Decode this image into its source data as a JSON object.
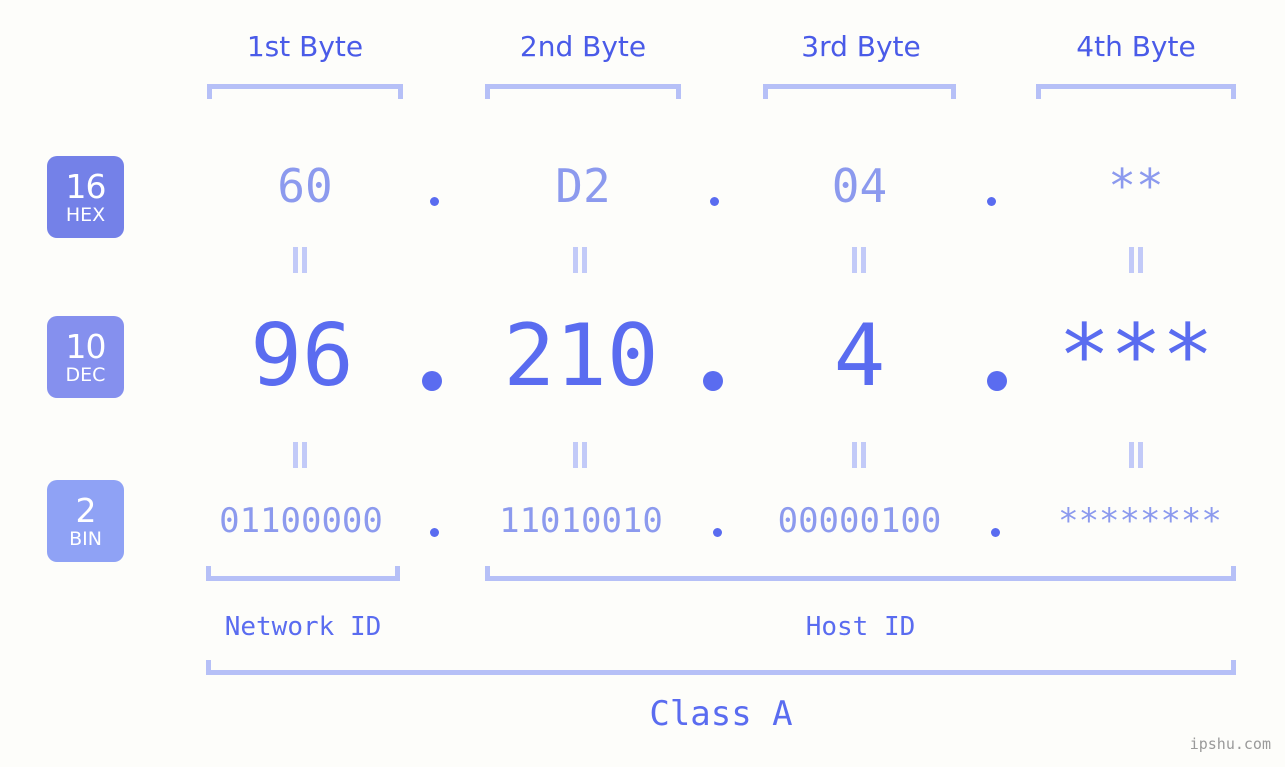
{
  "meta": {
    "watermark": "ipshu.com",
    "background_color": "#fdfdfa",
    "accent_color": "#5a6cf0",
    "accent_light_color": "#8c9aee",
    "bracket_color": "#b6c0f7"
  },
  "byte_headers": [
    {
      "label": "1st Byte"
    },
    {
      "label": "2nd Byte"
    },
    {
      "label": "3rd Byte"
    },
    {
      "label": "4th Byte"
    }
  ],
  "bases": [
    {
      "number": "16",
      "name": "HEX",
      "color": "#7481e8"
    },
    {
      "number": "10",
      "name": "DEC",
      "color": "#8590ee"
    },
    {
      "number": "2",
      "name": "BIN",
      "color": "#8fa2f5"
    }
  ],
  "rows": {
    "hex": {
      "base_number": "16",
      "base_name": "HEX",
      "values": [
        "60",
        "D2",
        "04",
        "**"
      ],
      "separator": "."
    },
    "dec": {
      "base_number": "10",
      "base_name": "DEC",
      "values": [
        "96",
        "210",
        "4",
        "***"
      ],
      "separator": "."
    },
    "bin": {
      "base_number": "2",
      "base_name": "BIN",
      "values": [
        "01100000",
        "11010010",
        "00000100",
        "********"
      ],
      "separator": "."
    }
  },
  "segments": {
    "network_id": "Network ID",
    "host_id": "Host ID",
    "class": "Class A"
  }
}
